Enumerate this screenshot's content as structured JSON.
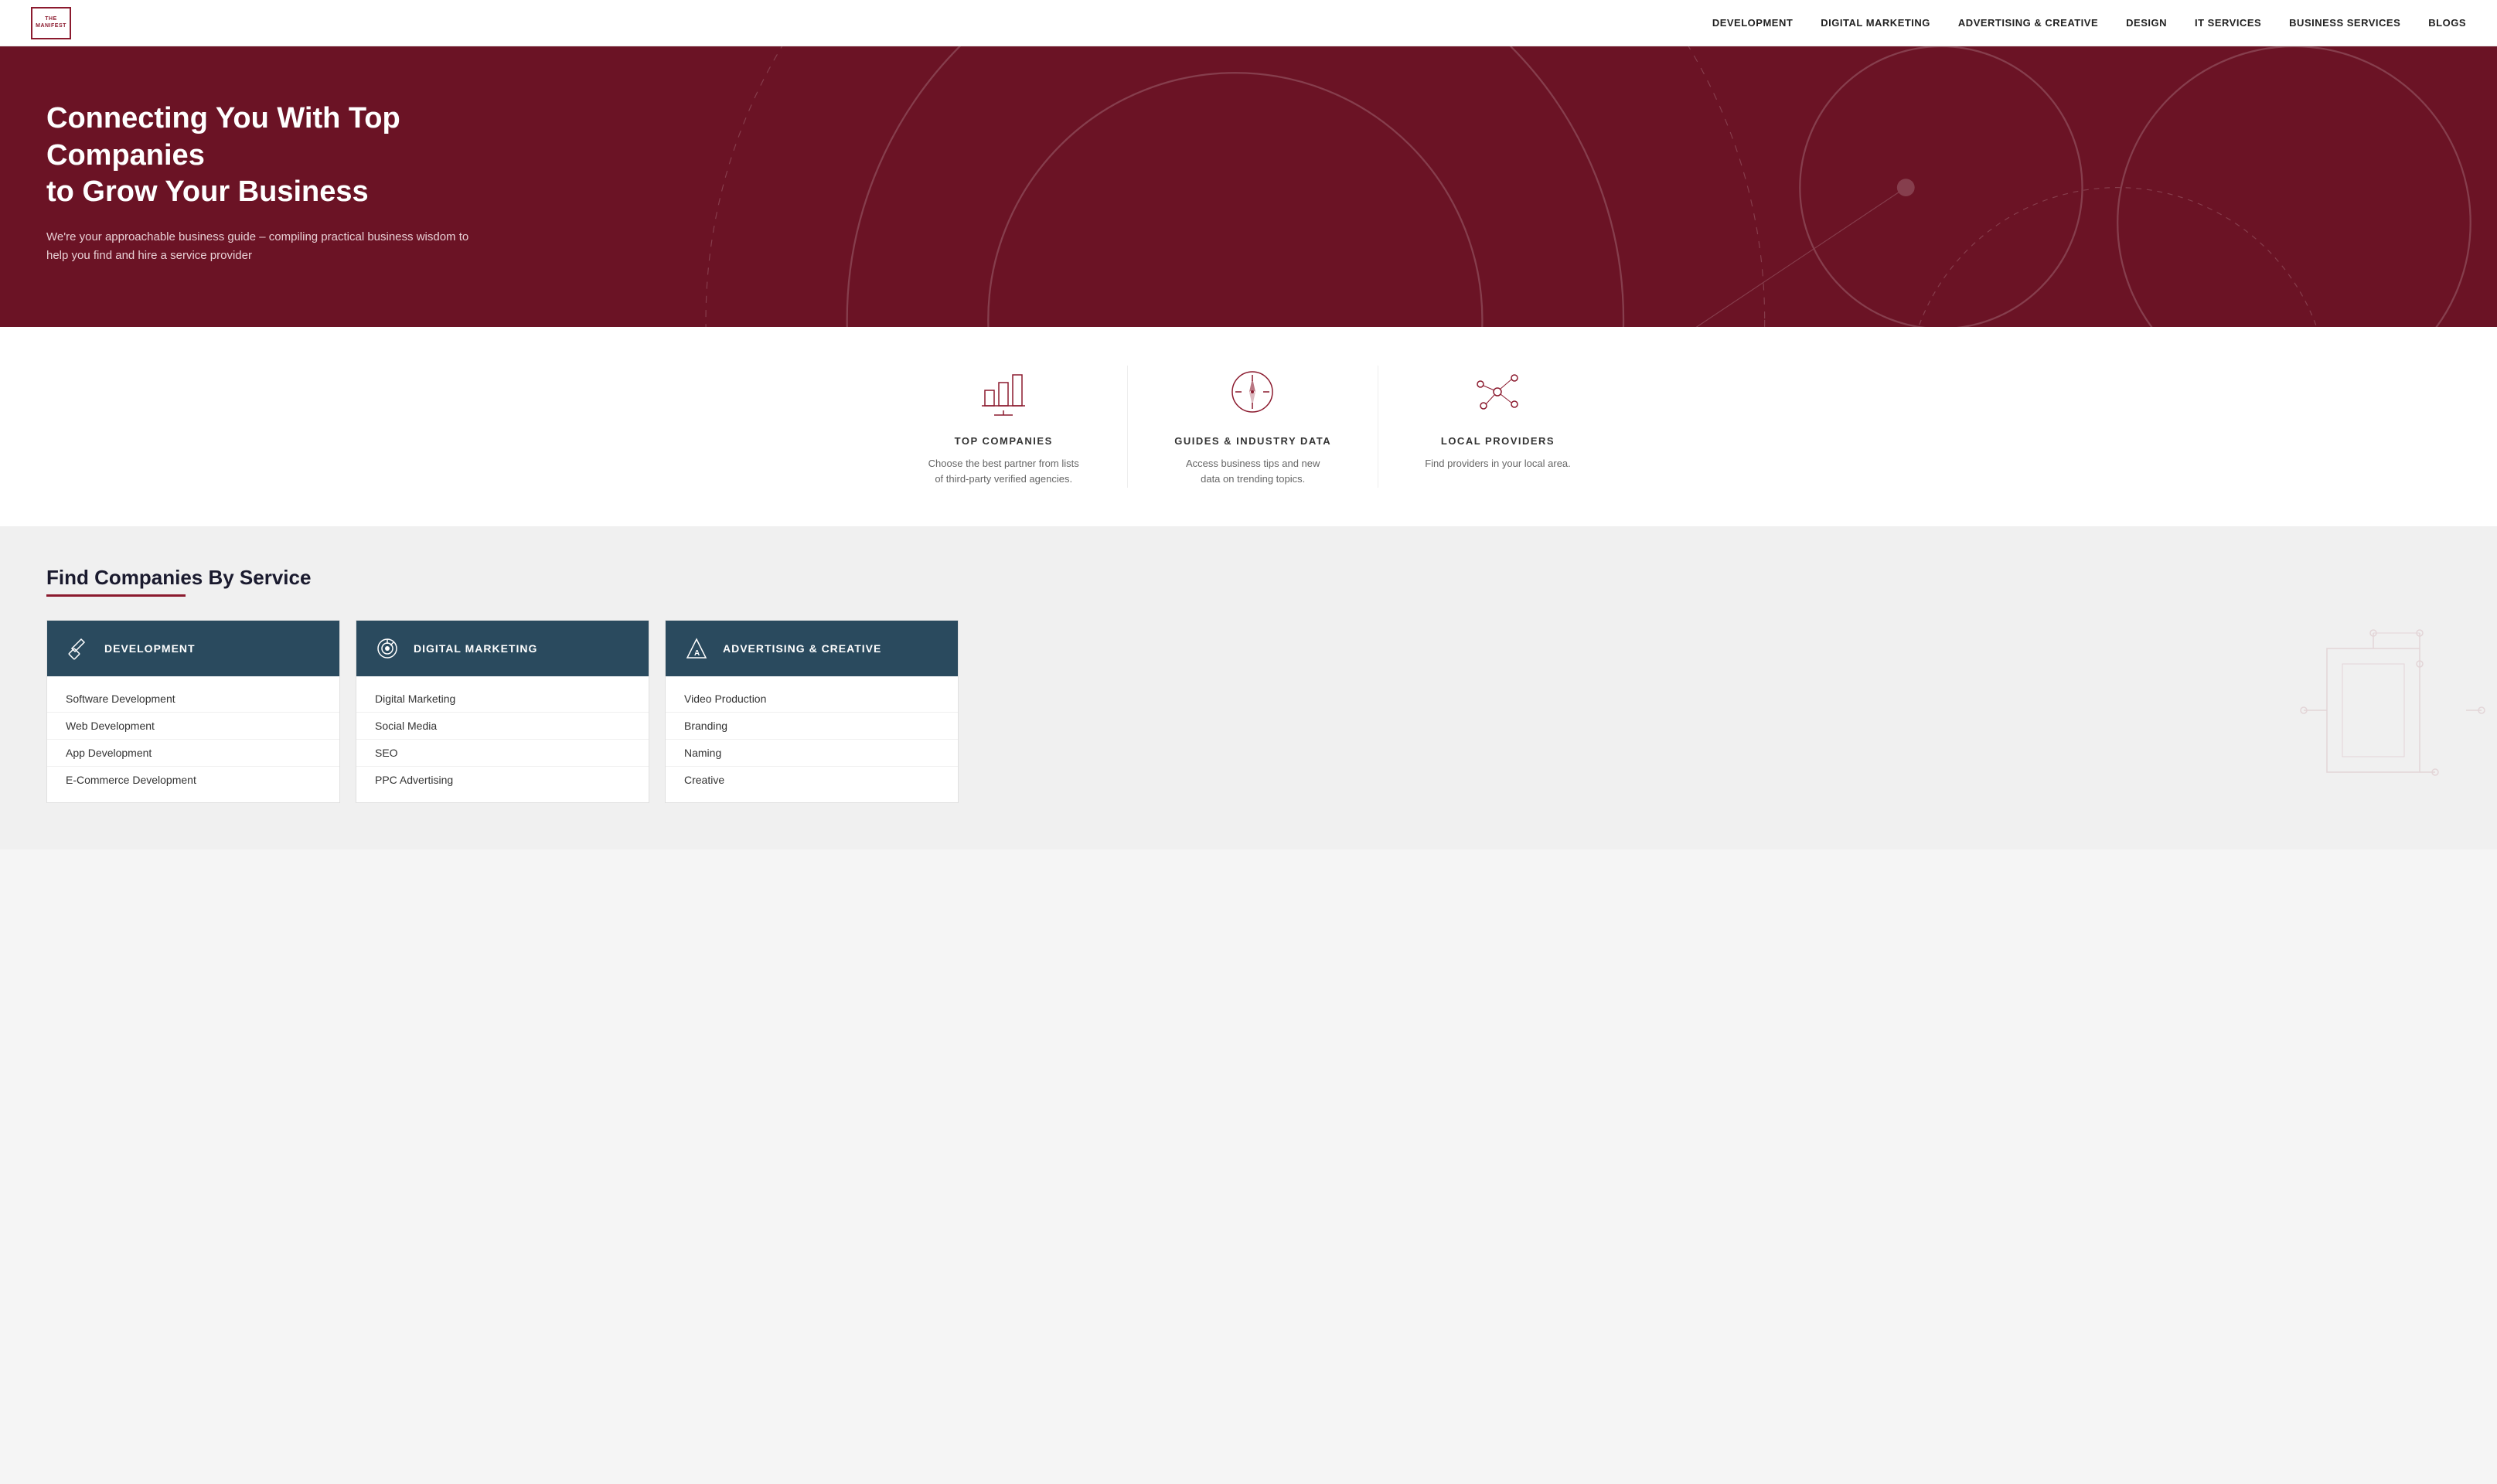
{
  "nav": {
    "logo_line1": "THE",
    "logo_line2": "MANIFEST",
    "links": [
      {
        "label": "DEVELOPMENT",
        "href": "#"
      },
      {
        "label": "DIGITAL MARKETING",
        "href": "#"
      },
      {
        "label": "ADVERTISING & CREATIVE",
        "href": "#"
      },
      {
        "label": "DESIGN",
        "href": "#"
      },
      {
        "label": "IT SERVICES",
        "href": "#"
      },
      {
        "label": "BUSINESS SERVICES",
        "href": "#"
      },
      {
        "label": "BLOGS",
        "href": "#"
      }
    ]
  },
  "hero": {
    "heading_line1": "Connecting You With Top Companies",
    "heading_line2": "to Grow Your Business",
    "subtext": "We're your approachable business guide – compiling practical business wisdom to help you find and hire a service provider"
  },
  "features": [
    {
      "icon": "chart-icon",
      "title": "TOP COMPANIES",
      "description": "Choose the best partner from lists of third-party verified agencies."
    },
    {
      "icon": "compass-icon",
      "title": "GUIDES & INDUSTRY DATA",
      "description": "Access business tips and new data on trending topics."
    },
    {
      "icon": "network-icon",
      "title": "LOCAL PROVIDERS",
      "description": "Find providers in your local area."
    }
  ],
  "find_section": {
    "heading": "Find Companies By Service",
    "cards": [
      {
        "header": "DEVELOPMENT",
        "theme": "dev",
        "items": [
          "Software Development",
          "Web Development",
          "App Development",
          "E-Commerce Development"
        ]
      },
      {
        "header": "DIGITAL MARKETING",
        "theme": "dig",
        "items": [
          "Digital Marketing",
          "Social Media",
          "SEO",
          "PPC Advertising"
        ]
      },
      {
        "header": "ADVERTISING & CREATIVE",
        "theme": "adv",
        "items": [
          "Video Production",
          "Branding",
          "Naming",
          "Creative"
        ]
      }
    ]
  }
}
